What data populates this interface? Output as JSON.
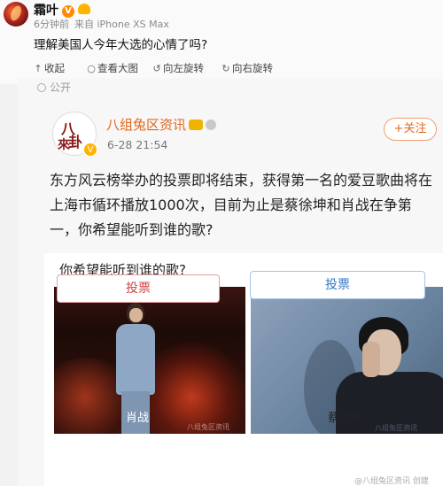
{
  "repost": {
    "username": "霜叶",
    "verified_badge": "V",
    "time": "6分钟前",
    "source": "来自 iPhone XS Max",
    "text": "理解美国人今年大选的心情了吗?"
  },
  "toolbar": {
    "collapse": "收起",
    "view_large": "查看大图",
    "rotate_left": "向左旋转",
    "rotate_right": "向右旋转"
  },
  "original": {
    "visibility_label": "公开",
    "avatar_chars": [
      "八",
      "卦",
      "來"
    ],
    "username": "八组兔区资讯",
    "time": "6-28 21:54",
    "follow_label": "+关注",
    "text": "东方风云榜举办的投票即将结束，获得第一名的爱豆歌曲将在上海市循环播放1000次，目前为止是蔡徐坤和肖战在争第一，你希望能听到谁的歌?"
  },
  "poll": {
    "question": "你希望能听到谁的歌?",
    "options": [
      {
        "name": "肖战",
        "vote_label": "投票",
        "watermark": "八组兔区资讯"
      },
      {
        "name": "蔡徐坤",
        "vote_label": "投票",
        "watermark": "八组兔区资讯"
      }
    ]
  },
  "footer": {
    "faint_text": "@八组兔区资讯 创建"
  },
  "colors": {
    "accent_orange": "#e2671b",
    "vote_left": "#d04444",
    "vote_right": "#3478c6"
  }
}
